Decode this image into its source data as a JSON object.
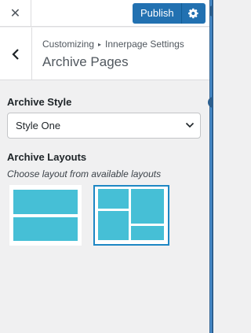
{
  "header": {
    "close_label": "✕",
    "publish_label": "Publish"
  },
  "section": {
    "breadcrumb_root": "Customizing",
    "breadcrumb_separator": "▸",
    "breadcrumb_parent": "Innerpage Settings",
    "title": "Archive Pages"
  },
  "archive_style": {
    "label": "Archive Style",
    "selected": "Style One"
  },
  "archive_layouts": {
    "label": "Archive Layouts",
    "description": "Choose layout from available layouts",
    "options": [
      {
        "name": "two-row layout",
        "selected": false
      },
      {
        "name": "grid layout",
        "selected": true
      }
    ]
  },
  "colors": {
    "accent": "#2271b1",
    "layout_block": "#46bfd6",
    "selected_border": "#1e87c4"
  }
}
